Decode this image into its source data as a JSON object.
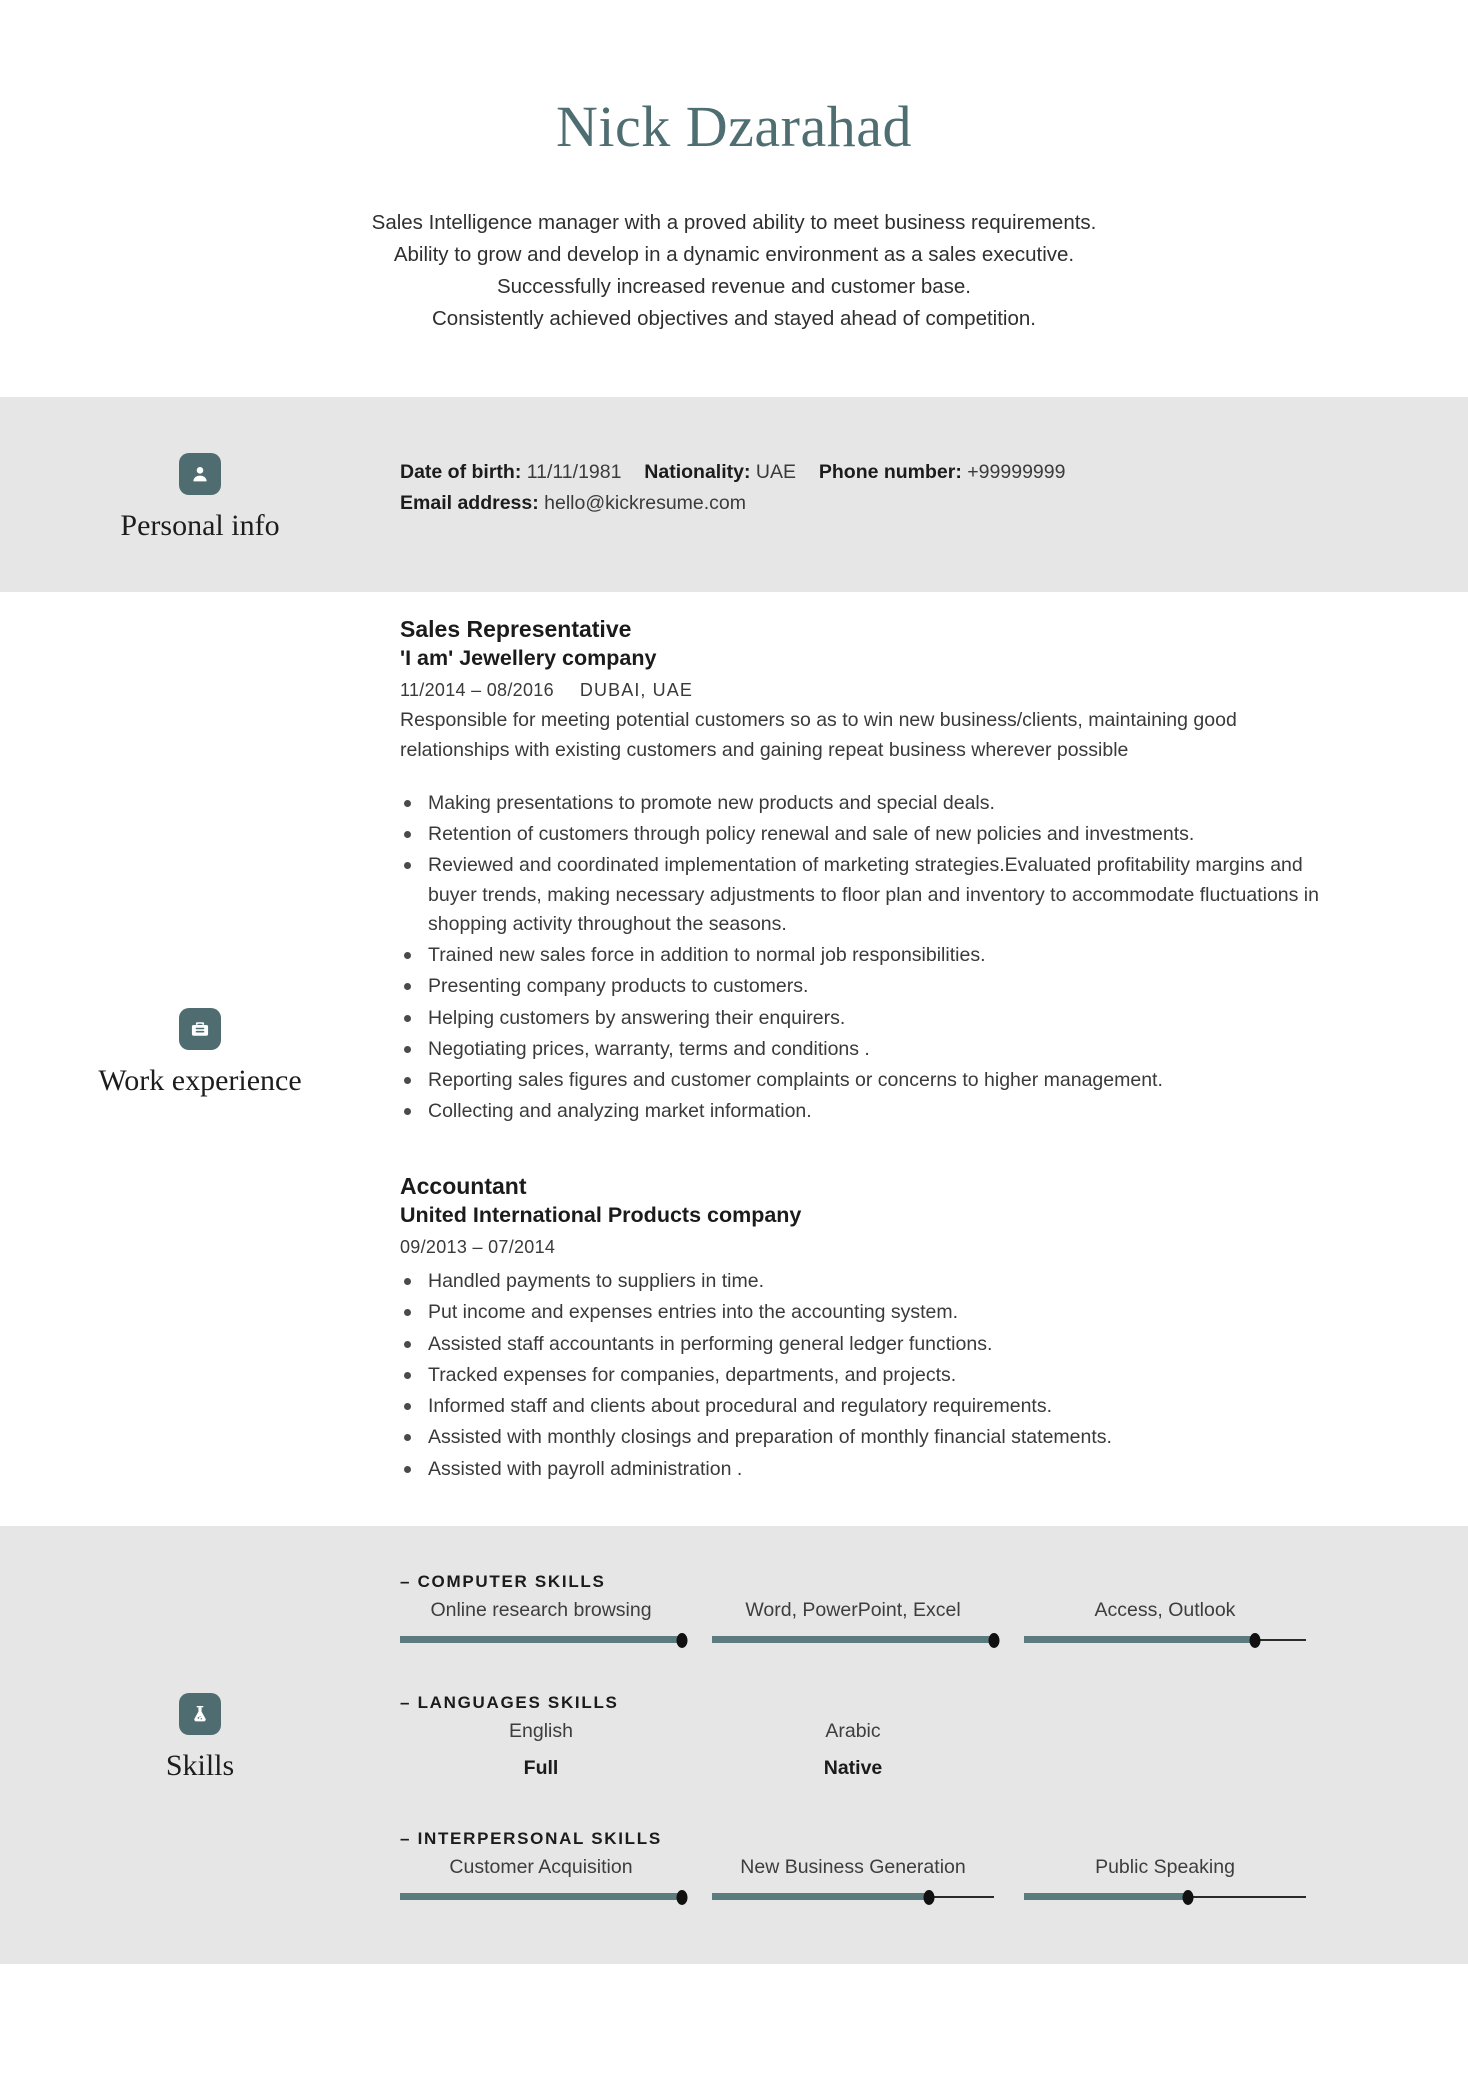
{
  "theme": {
    "accent": "#4f6e72",
    "badge_bg": "#4f6d70",
    "shaded_bg": "#e6e6e6",
    "slider_fill": "#5b7b7e",
    "text": "#3a3a3a"
  },
  "header": {
    "name": "Nick Dzarahad",
    "summary_lines": [
      "Sales Intelligence manager with a proved ability to meet business requirements.",
      "Ability to grow and develop in a dynamic environment as a sales executive.",
      "Successfully increased revenue and customer base.",
      "Consistently achieved objectives and stayed ahead of competition."
    ]
  },
  "sections": {
    "personal": {
      "label": "Personal info",
      "icon": "person-icon",
      "fields": [
        {
          "key": "Date of birth:",
          "value": "11/11/1981"
        },
        {
          "key": "Nationality:",
          "value": "UAE"
        },
        {
          "key": "Phone number:",
          "value": "+99999999"
        },
        {
          "key": "Email address:",
          "value": "hello@kickresume.com"
        }
      ]
    },
    "work": {
      "label": "Work experience",
      "icon": "briefcase-icon",
      "jobs": [
        {
          "title": "Sales Representative",
          "company": "'I am' Jewellery company",
          "dates": "11/2014 – 08/2016",
          "location": "DUBAI, UAE",
          "description": "Responsible for meeting potential customers so as to win new business/clients, maintaining good relationships with existing customers and gaining repeat business wherever possible",
          "bullets": [
            "Making presentations to promote new products and special deals.",
            "Retention of customers through policy renewal and sale of new policies and investments.",
            "Reviewed and coordinated implementation of marketing strategies.Evaluated profitability margins and buyer trends, making necessary adjustments to floor plan and inventory to accommodate fluctuations in shopping activity throughout the seasons.",
            "Trained new sales force in addition to normal job responsibilities.",
            "Presenting company products to customers.",
            "Helping customers by answering their enquirers.",
            "Negotiating prices, warranty, terms and conditions .",
            "Reporting sales figures and customer complaints or concerns to higher management.",
            "Collecting and analyzing market information."
          ]
        },
        {
          "title": "Accountant",
          "company": "United International Products company",
          "dates": "09/2013 – 07/2014",
          "location": "",
          "description": "",
          "bullets": [
            "Handled payments to suppliers in time.",
            "Put income and expenses entries into the accounting system.",
            "Assisted staff accountants in performing general ledger functions.",
            "Tracked expenses for companies, departments, and projects.",
            "Informed staff and clients about procedural and regulatory requirements.",
            "Assisted with monthly closings and preparation of monthly financial statements.",
            "Assisted with payroll administration ."
          ]
        }
      ]
    },
    "skills": {
      "label": "Skills",
      "icon": "flask-icon",
      "groups": [
        {
          "title": "– COMPUTER SKILLS",
          "type": "slider",
          "items": [
            {
              "name": "Online research browsing",
              "value": 100
            },
            {
              "name": "Word, PowerPoint, Excel",
              "value": 100
            },
            {
              "name": "Access, Outlook",
              "value": 82
            }
          ]
        },
        {
          "title": "– LANGUAGES SKILLS",
          "type": "level",
          "items": [
            {
              "name": "English",
              "level": "Full"
            },
            {
              "name": "Arabic",
              "level": "Native"
            }
          ]
        },
        {
          "title": "– INTERPERSONAL SKILLS",
          "type": "slider",
          "items": [
            {
              "name": "Customer Acquisition",
              "value": 100
            },
            {
              "name": "New Business Generation",
              "value": 77
            },
            {
              "name": "Public Speaking",
              "value": 58
            }
          ]
        }
      ]
    }
  }
}
